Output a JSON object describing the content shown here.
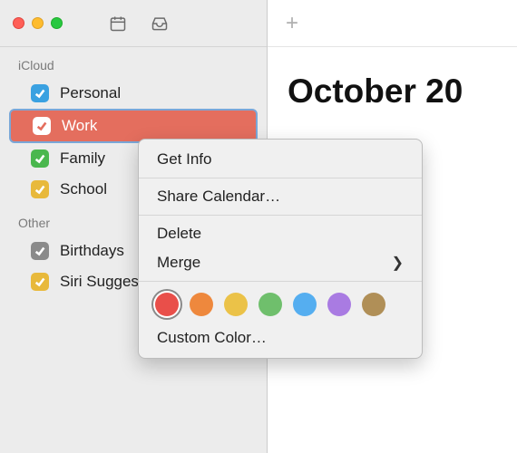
{
  "sidebar": {
    "sections": [
      {
        "label": "iCloud",
        "items": [
          {
            "name": "Personal",
            "color": "#3aa1e1",
            "selected": false
          },
          {
            "name": "Work",
            "color": "#e46e5e",
            "selected": true
          },
          {
            "name": "Family",
            "color": "#4ab74e",
            "selected": false
          },
          {
            "name": "School",
            "color": "#e8b93b",
            "selected": false
          }
        ]
      },
      {
        "label": "Other",
        "items": [
          {
            "name": "Birthdays",
            "color": "#8a8a8a",
            "selected": false
          },
          {
            "name": "Siri Suggestions",
            "color": "#e8b93b",
            "selected": false
          }
        ]
      }
    ]
  },
  "main": {
    "title": "October 20"
  },
  "context_menu": {
    "get_info": "Get Info",
    "share": "Share Calendar…",
    "delete": "Delete",
    "merge": "Merge",
    "custom_color": "Custom Color…",
    "colors": [
      {
        "name": "red",
        "hex": "#e94f4a",
        "active": true
      },
      {
        "name": "orange",
        "hex": "#ee883d",
        "active": false
      },
      {
        "name": "yellow",
        "hex": "#ebc248",
        "active": false
      },
      {
        "name": "green",
        "hex": "#6fbf6c",
        "active": false
      },
      {
        "name": "blue",
        "hex": "#55aef0",
        "active": false
      },
      {
        "name": "purple",
        "hex": "#a97be2",
        "active": false
      },
      {
        "name": "brown",
        "hex": "#b08f57",
        "active": false
      }
    ]
  }
}
